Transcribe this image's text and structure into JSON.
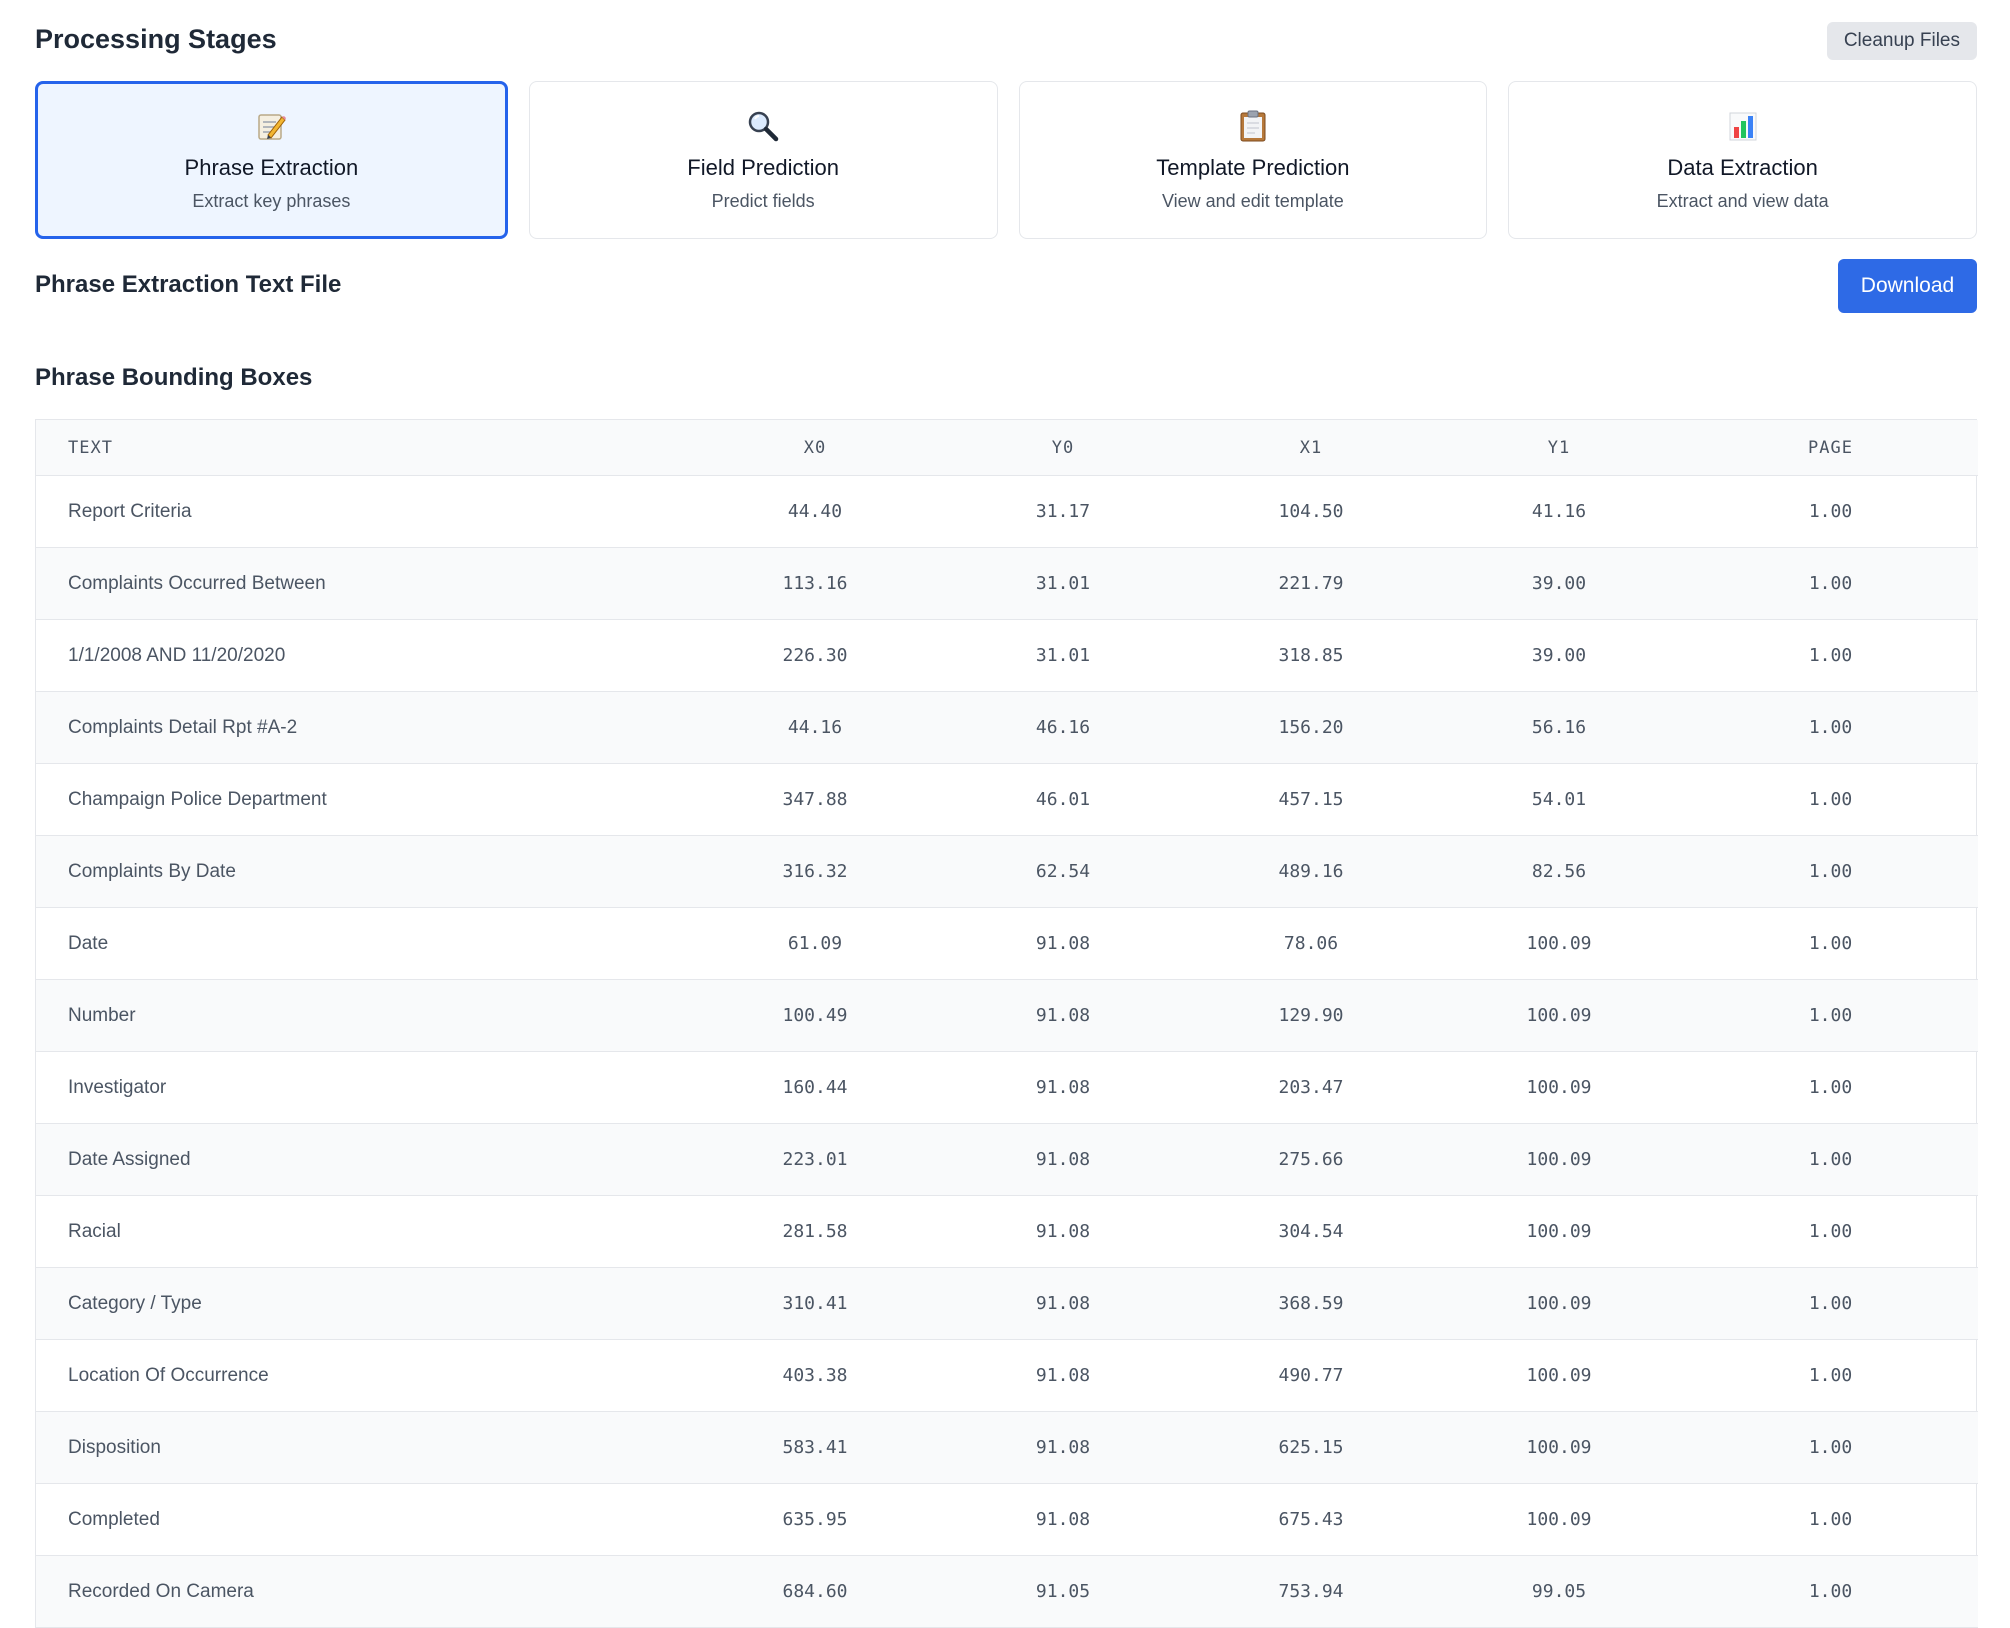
{
  "header": {
    "title": "Processing Stages",
    "cleanup_label": "Cleanup Files"
  },
  "stages": [
    {
      "icon": "memo-icon",
      "title": "Phrase Extraction",
      "subtitle": "Extract key phrases",
      "active": true
    },
    {
      "icon": "magnifier-icon",
      "title": "Field Prediction",
      "subtitle": "Predict fields",
      "active": false
    },
    {
      "icon": "clipboard-icon",
      "title": "Template Prediction",
      "subtitle": "View and edit template",
      "active": false
    },
    {
      "icon": "bar-chart-icon",
      "title": "Data Extraction",
      "subtitle": "Extract and view data",
      "active": false
    }
  ],
  "text_file": {
    "title": "Phrase Extraction Text File",
    "download_label": "Download"
  },
  "bbox": {
    "title": "Phrase Bounding Boxes",
    "columns": [
      "TEXT",
      "X0",
      "Y0",
      "X1",
      "Y1",
      "PAGE"
    ],
    "rows": [
      [
        "Report Criteria",
        "44.40",
        "31.17",
        "104.50",
        "41.16",
        "1.00"
      ],
      [
        "Complaints Occurred Between",
        "113.16",
        "31.01",
        "221.79",
        "39.00",
        "1.00"
      ],
      [
        "1/1/2008 AND 11/20/2020",
        "226.30",
        "31.01",
        "318.85",
        "39.00",
        "1.00"
      ],
      [
        "Complaints Detail Rpt #A-2",
        "44.16",
        "46.16",
        "156.20",
        "56.16",
        "1.00"
      ],
      [
        "Champaign Police Department",
        "347.88",
        "46.01",
        "457.15",
        "54.01",
        "1.00"
      ],
      [
        "Complaints By Date",
        "316.32",
        "62.54",
        "489.16",
        "82.56",
        "1.00"
      ],
      [
        "Date",
        "61.09",
        "91.08",
        "78.06",
        "100.09",
        "1.00"
      ],
      [
        "Number",
        "100.49",
        "91.08",
        "129.90",
        "100.09",
        "1.00"
      ],
      [
        "Investigator",
        "160.44",
        "91.08",
        "203.47",
        "100.09",
        "1.00"
      ],
      [
        "Date Assigned",
        "223.01",
        "91.08",
        "275.66",
        "100.09",
        "1.00"
      ],
      [
        "Racial",
        "281.58",
        "91.08",
        "304.54",
        "100.09",
        "1.00"
      ],
      [
        "Category / Type",
        "310.41",
        "91.08",
        "368.59",
        "100.09",
        "1.00"
      ],
      [
        "Location Of Occurrence",
        "403.38",
        "91.08",
        "490.77",
        "100.09",
        "1.00"
      ],
      [
        "Disposition",
        "583.41",
        "91.08",
        "625.15",
        "100.09",
        "1.00"
      ],
      [
        "Completed",
        "635.95",
        "91.08",
        "675.43",
        "100.09",
        "1.00"
      ],
      [
        "Recorded On Camera",
        "684.60",
        "91.05",
        "753.94",
        "99.05",
        "1.00"
      ]
    ]
  },
  "colors": {
    "accent": "#2563eb",
    "active_bg": "#eef5ff",
    "download_bg": "#2e6ae6",
    "cleanup_bg": "#e5e7eb",
    "stripe": "#f9fafb"
  }
}
